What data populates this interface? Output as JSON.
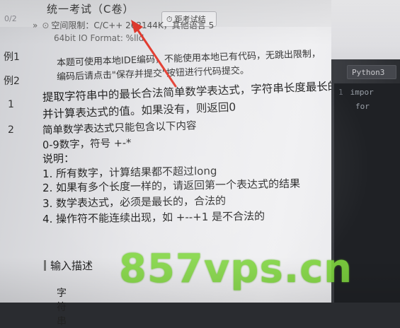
{
  "header": {
    "exam_title": "统一考试（C卷）",
    "countdown_label": "距考试结",
    "progress": "0/2"
  },
  "sidebar": {
    "tabs": [
      {
        "label": "例1"
      },
      {
        "label": "例2"
      }
    ],
    "numbers": [
      "1",
      "2"
    ]
  },
  "problem": {
    "meta_line1": "空间限制：C/C++ 262144K，其他语言 5",
    "meta_line2": "64bit IO Format: %lld",
    "notice_line1": "本题可使用本地IDE编码，不能使用本地已有代码，无跳出限制，",
    "notice_line2": "编码后请点击\"保存并提交\"按钮进行代码提交。",
    "lines": [
      "提取字符串中的最长合法简单数学表达式，字符串长度最长的，",
      "并计算表达式的值。如果没有，则返回0",
      "简单数学表达式只能包含以下内容",
      "0-9数字，符号 +-*",
      "说明：",
      "1. 所有数字，计算结果都不超过long",
      "2. 如果有多个长度一样的，请返回第一个表达式的结果",
      "3. 数学表达式，必须是最长的，合法的",
      "4. 操作符不能连续出现，如 +--+1 是不合法的"
    ],
    "input_section_title": "输入描述",
    "input_value": "字符串"
  },
  "editor": {
    "language": "Python3",
    "code_lines": [
      {
        "num": "1",
        "text": "impor"
      },
      {
        "num": "",
        "text": "for"
      }
    ]
  },
  "watermark": "857vps.cn",
  "colors": {
    "watermark": "#7fd63e",
    "annotation_arrow": "#e23a2e",
    "editor_bg": "#1f2125"
  }
}
